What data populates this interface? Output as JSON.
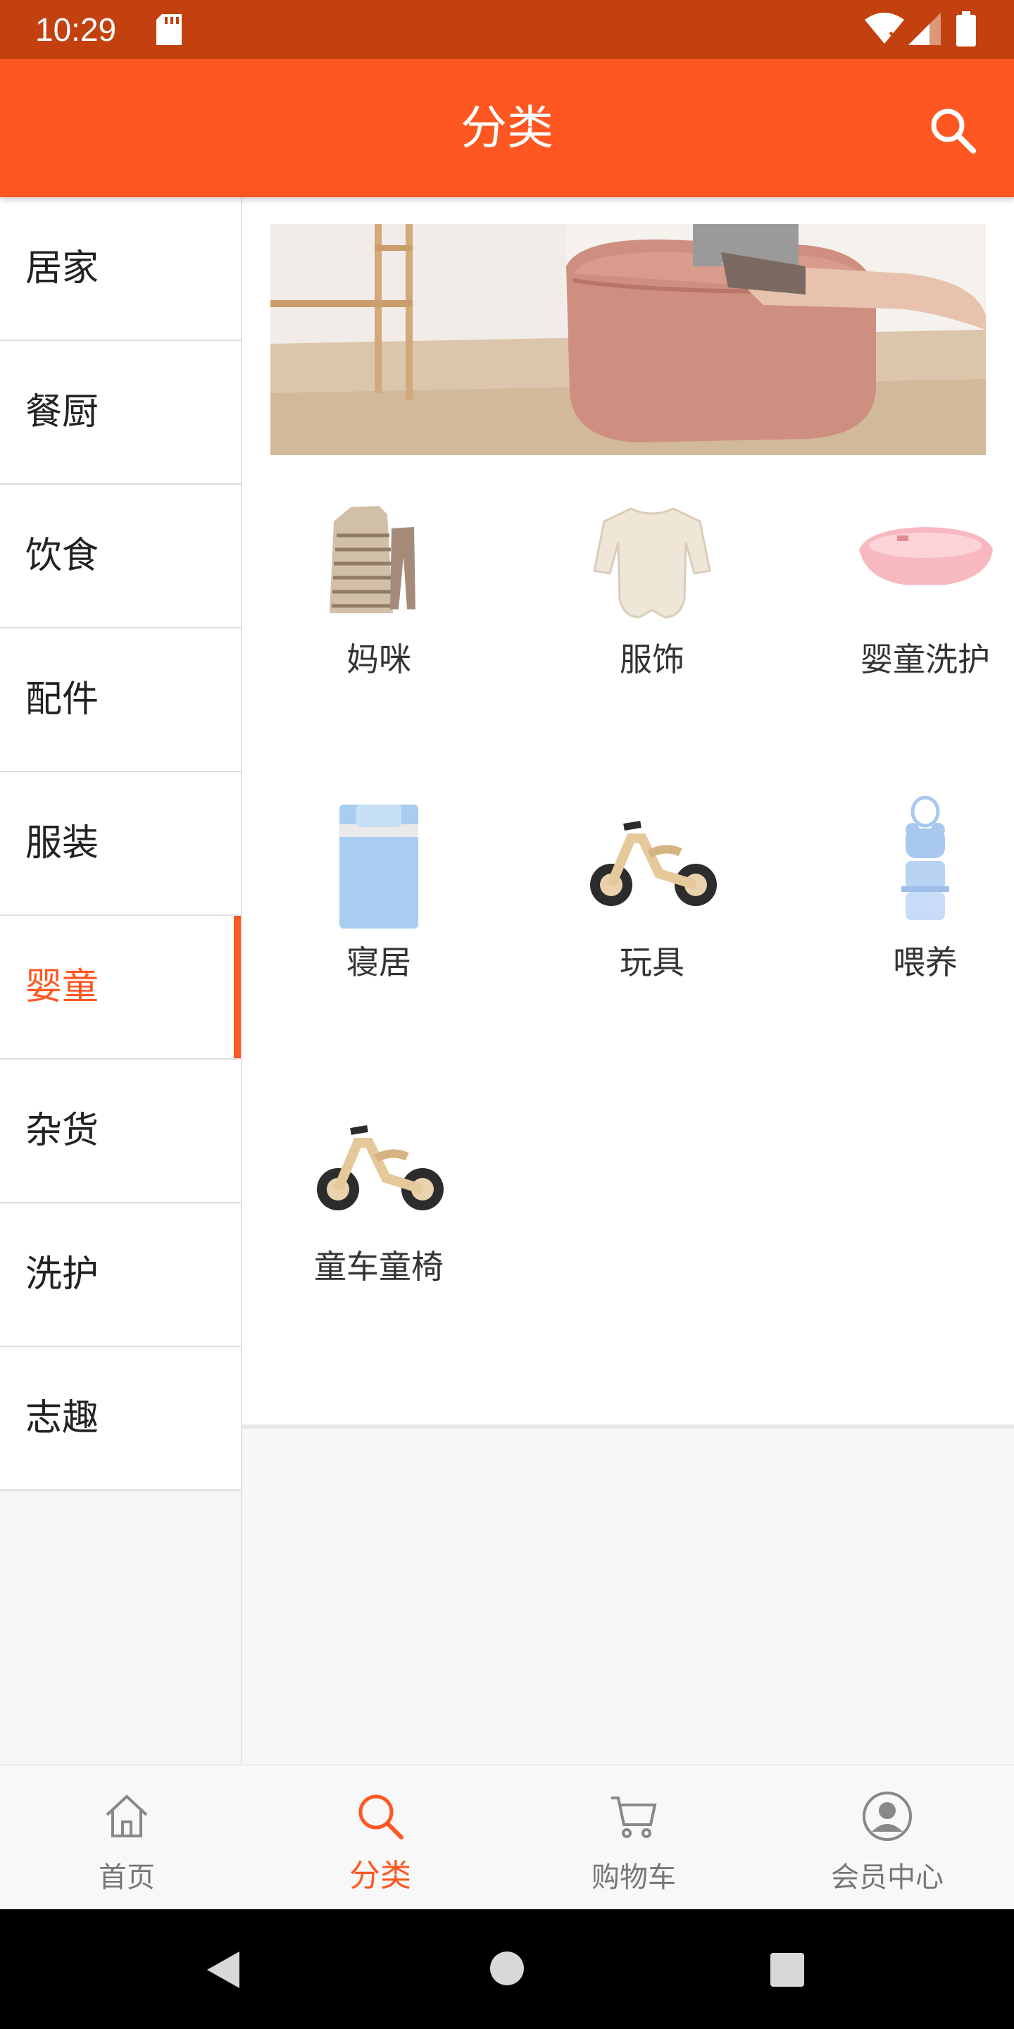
{
  "status_bar": {
    "time": "10:29"
  },
  "header": {
    "title": "分类",
    "search_icon": "search-icon"
  },
  "sidebar": {
    "items": [
      {
        "label": "居家"
      },
      {
        "label": "餐厨"
      },
      {
        "label": "饮食"
      },
      {
        "label": "配件"
      },
      {
        "label": "服装"
      },
      {
        "label": "婴童",
        "active": true
      },
      {
        "label": "杂货"
      },
      {
        "label": "洗护"
      },
      {
        "label": "志趣"
      }
    ]
  },
  "main": {
    "subcategories": [
      {
        "label": "妈咪",
        "icon": "clothing-set-icon"
      },
      {
        "label": "服饰",
        "icon": "baby-bodysuit-icon"
      },
      {
        "label": "婴童洗护",
        "icon": "baby-bathtub-icon"
      },
      {
        "label": "寝居",
        "icon": "crib-bedding-icon"
      },
      {
        "label": "玩具",
        "icon": "balance-bike-icon"
      },
      {
        "label": "喂养",
        "icon": "formula-dispenser-icon"
      },
      {
        "label": "童车童椅",
        "icon": "balance-bike-icon"
      }
    ]
  },
  "bottom_nav": {
    "tabs": [
      {
        "label": "首页",
        "icon": "home-icon"
      },
      {
        "label": "分类",
        "icon": "search-icon",
        "active": true
      },
      {
        "label": "购物车",
        "icon": "cart-icon"
      },
      {
        "label": "会员中心",
        "icon": "user-icon"
      }
    ]
  },
  "colors": {
    "accent": "#ff5722",
    "status_bar": "#c2410e"
  }
}
